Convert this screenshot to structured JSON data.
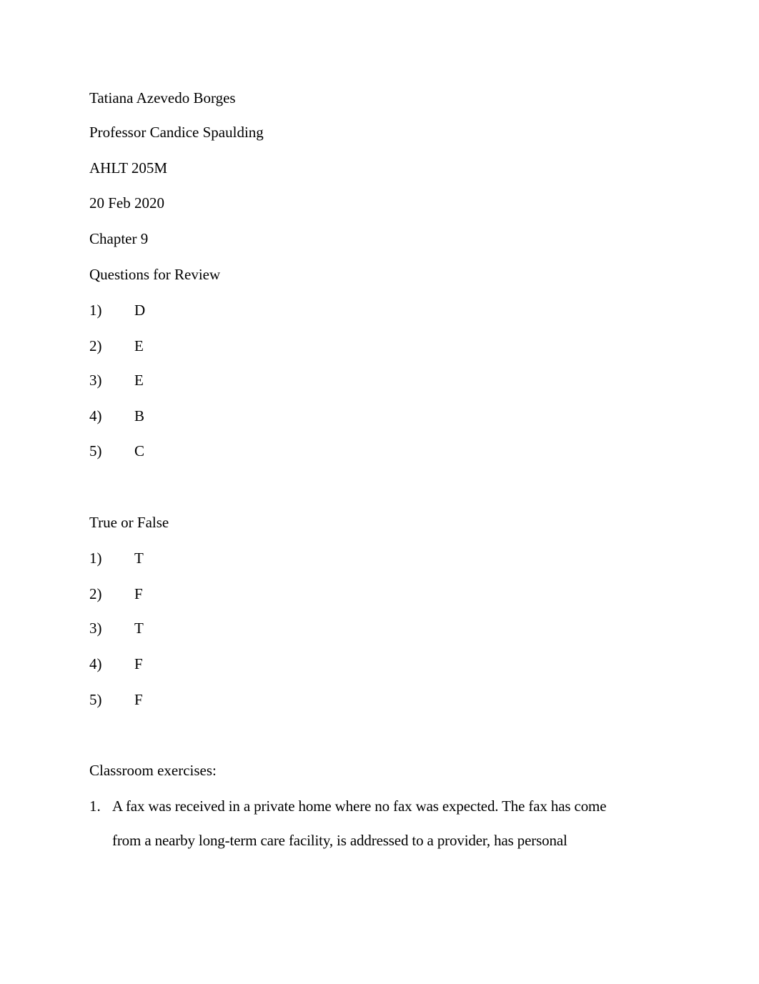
{
  "header": {
    "student": "Tatiana Azevedo Borges",
    "professor": "Professor Candice Spaulding",
    "course": "AHLT 205M",
    "date": "20 Feb 2020",
    "chapter": "Chapter 9"
  },
  "review": {
    "heading": "Questions for Review",
    "items": [
      {
        "num": "1)",
        "answer": "D"
      },
      {
        "num": "2)",
        "answer": "E"
      },
      {
        "num": "3)",
        "answer": "E"
      },
      {
        "num": "4)",
        "answer": "B"
      },
      {
        "num": "5)",
        "answer": "C"
      }
    ]
  },
  "true_false": {
    "heading": "True or False",
    "items": [
      {
        "num": "1)",
        "answer": "T"
      },
      {
        "num": "2)",
        "answer": "F"
      },
      {
        "num": "3)",
        "answer": "T"
      },
      {
        "num": "4)",
        "answer": "F"
      },
      {
        "num": "5)",
        "answer": "F"
      }
    ]
  },
  "exercises": {
    "heading": "Classroom exercises:",
    "items": [
      {
        "num": "1.",
        "lines": [
          "A fax was received in a private home where no fax was expected. The fax has come",
          "from a nearby long-term care facility, is addressed to a provider, has personal"
        ]
      }
    ]
  }
}
